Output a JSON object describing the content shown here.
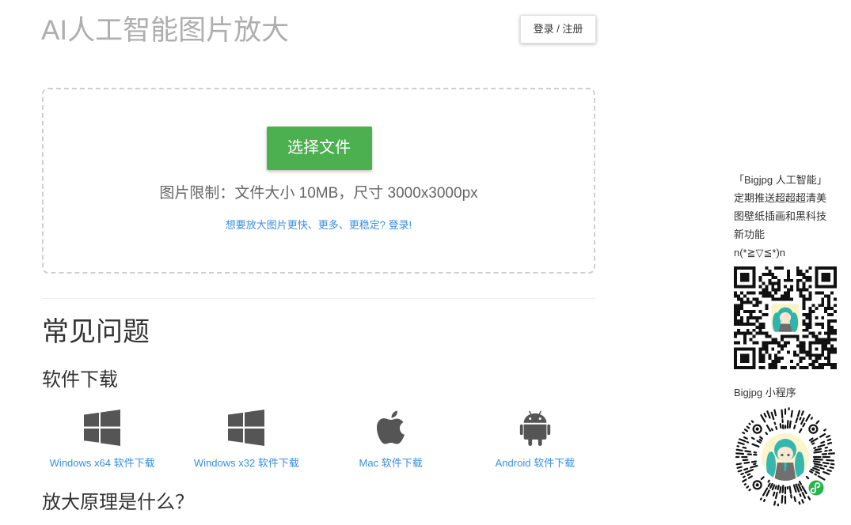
{
  "header": {
    "title": "AI人工智能图片放大",
    "login_label": "登录 / 注册"
  },
  "upload": {
    "select_label": "选择文件",
    "limit_text": "图片限制：文件大小 10MB，尺寸 3000x3000px",
    "login_prompt": "想要放大图片更快、更多、更稳定? 登录!"
  },
  "faq": {
    "heading": "常见问题",
    "download_heading": "软件下载",
    "downloads": [
      {
        "label": "Windows x64 软件下载",
        "icon": "windows-icon"
      },
      {
        "label": "Windows x32 软件下载",
        "icon": "windows-icon"
      },
      {
        "label": "Mac 软件下载",
        "icon": "apple-icon"
      },
      {
        "label": "Android 软件下载",
        "icon": "android-icon"
      }
    ],
    "principle_heading": "放大原理是什么？"
  },
  "sidebar": {
    "promo_lines": [
      "「Bigjpg 人工智能」",
      "定期推送超超超清美",
      "图壁纸插画和黑科技",
      "新功能",
      "n(*≧▽≦*)n"
    ],
    "qr_icon": "wechat-official-account-qr-code",
    "mini_program_label": "Bigjpg 小程序",
    "mini_program_icon": "wechat-mini-program-code"
  },
  "colors": {
    "accent_green": "#4caf50",
    "link_blue": "#3a8ee0",
    "title_gray": "#aeaeae",
    "icon_gray": "#555555"
  }
}
